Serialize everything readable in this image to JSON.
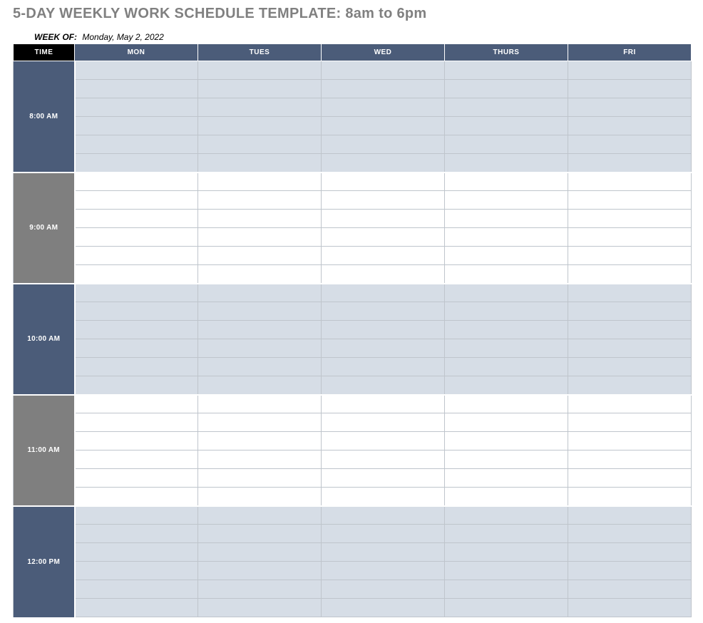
{
  "title": "5-DAY WEEKLY WORK SCHEDULE TEMPLATE: 8am to 6pm",
  "week_of_label": "WEEK OF:",
  "week_of_value": "Monday, May 2, 2022",
  "headers": {
    "time": "TIME",
    "days": [
      "MON",
      "TUES",
      "WED",
      "THURS",
      "FRI"
    ]
  },
  "time_blocks": [
    {
      "label": "8:00 AM",
      "rows": 6
    },
    {
      "label": "9:00 AM",
      "rows": 6
    },
    {
      "label": "10:00 AM",
      "rows": 6
    },
    {
      "label": "11:00 AM",
      "rows": 6
    },
    {
      "label": "12:00 PM",
      "rows": 6
    }
  ]
}
